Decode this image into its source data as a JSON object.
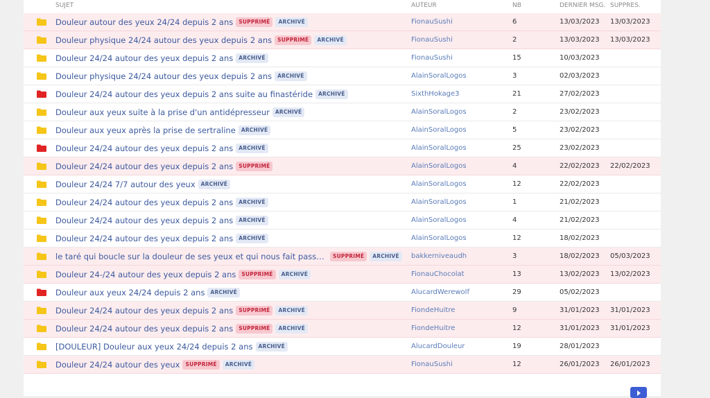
{
  "colors": {
    "folder_yellow": "#f5c518",
    "folder_red": "#e02424"
  },
  "badges": {
    "supprime": "SUPPRIMÉ",
    "archive": "ARCHIVÉ"
  },
  "header": {
    "sujet": "SUJET",
    "auteur": "AUTEUR",
    "nb": "NB",
    "dernier": "DERNIER MSG.",
    "suppres": "SUPPRES."
  },
  "rows": [
    {
      "icon": "yellow",
      "subject": "Douleur autour des yeux 24/24 depuis 2 ans",
      "supprime": true,
      "archive": true,
      "author": "FionauSushi",
      "nb": "6",
      "last": "13/03/2023",
      "deleted": "13/03/2023"
    },
    {
      "icon": "yellow",
      "subject": "Douleur physique 24/24 autour des yeux depuis 2 ans",
      "supprime": true,
      "archive": true,
      "author": "FionauSushi",
      "nb": "2",
      "last": "13/03/2023",
      "deleted": "13/03/2023"
    },
    {
      "icon": "yellow",
      "subject": "Douleur 24/24 autour des yeux depuis 2 ans",
      "supprime": false,
      "archive": true,
      "author": "FionauSushi",
      "nb": "15",
      "last": "10/03/2023",
      "deleted": ""
    },
    {
      "icon": "yellow",
      "subject": "Douleur physique 24/24 autour des yeux depuis 2 ans",
      "supprime": false,
      "archive": true,
      "author": "AlainSoralLogos",
      "nb": "3",
      "last": "02/03/2023",
      "deleted": ""
    },
    {
      "icon": "red",
      "subject": "Douleur 24/24 autour des yeux depuis 2 ans suite au finastéride",
      "supprime": false,
      "archive": true,
      "author": "SixthHokage3",
      "nb": "21",
      "last": "27/02/2023",
      "deleted": ""
    },
    {
      "icon": "yellow",
      "subject": "Douleur aux yeux suite à la prise d'un antidépresseur",
      "supprime": false,
      "archive": true,
      "author": "AlainSoralLogos",
      "nb": "2",
      "last": "23/02/2023",
      "deleted": ""
    },
    {
      "icon": "yellow",
      "subject": "Douleur aux yeux après la prise de sertraline",
      "supprime": false,
      "archive": true,
      "author": "AlainSoralLogos",
      "nb": "5",
      "last": "23/02/2023",
      "deleted": ""
    },
    {
      "icon": "red",
      "subject": "Douleur 24/24 autour des yeux depuis 2 ans",
      "supprime": false,
      "archive": true,
      "author": "AlainSoralLogos",
      "nb": "25",
      "last": "23/02/2023",
      "deleted": ""
    },
    {
      "icon": "yellow",
      "subject": "Douleur 24/24 autour des yeux depuis 2 ans",
      "supprime": true,
      "archive": false,
      "author": "AlainSoralLogos",
      "nb": "4",
      "last": "22/02/2023",
      "deleted": "22/02/2023"
    },
    {
      "icon": "yellow",
      "subject": "Douleur 24/24 7/7 autour des yeux",
      "supprime": false,
      "archive": true,
      "author": "AlainSoralLogos",
      "nb": "12",
      "last": "22/02/2023",
      "deleted": ""
    },
    {
      "icon": "yellow",
      "subject": "Douleur 24/24 autour des yeux depuis 2 ans",
      "supprime": false,
      "archive": true,
      "author": "AlainSoralLogos",
      "nb": "1",
      "last": "21/02/2023",
      "deleted": ""
    },
    {
      "icon": "yellow",
      "subject": "Douleur 24/24 autour des yeux depuis 2 ans",
      "supprime": false,
      "archive": true,
      "author": "AlainSoralLogos",
      "nb": "4",
      "last": "21/02/2023",
      "deleted": ""
    },
    {
      "icon": "yellow",
      "subject": "Douleur 24/24 autour des yeux depuis 2 ans",
      "supprime": false,
      "archive": true,
      "author": "AlainSoralLogos",
      "nb": "12",
      "last": "18/02/2023",
      "deleted": ""
    },
    {
      "icon": "yellow",
      "subject": "le taré qui boucle sur la douleur de ses yeux et qui nous fait passer pour d...",
      "supprime": true,
      "archive": true,
      "author": "bakkerniveaudh",
      "nb": "3",
      "last": "18/02/2023",
      "deleted": "05/03/2023"
    },
    {
      "icon": "yellow",
      "subject": "Douleur 24-/24 autour des yeux depuis 2 ans",
      "supprime": true,
      "archive": true,
      "author": "FionauChocolat",
      "nb": "13",
      "last": "13/02/2023",
      "deleted": "13/02/2023"
    },
    {
      "icon": "red",
      "subject": "Douleur aux yeux 24/24 depuis 2 ans",
      "supprime": false,
      "archive": true,
      "author": "AlucardWerewolf",
      "nb": "29",
      "last": "05/02/2023",
      "deleted": ""
    },
    {
      "icon": "yellow",
      "subject": "Douleur 24/24 autour des yeux depuis 2 ans",
      "supprime": true,
      "archive": true,
      "author": "FiondeHuitre",
      "nb": "9",
      "last": "31/01/2023",
      "deleted": "31/01/2023"
    },
    {
      "icon": "yellow",
      "subject": "Douleur 24/24 autour des yeux depuis 2 ans",
      "supprime": true,
      "archive": true,
      "author": "FiondeHuitre",
      "nb": "12",
      "last": "31/01/2023",
      "deleted": "31/01/2023"
    },
    {
      "icon": "yellow",
      "subject": "[DOULEUR] Douleur aux yeux 24/24 depuis 2 ans",
      "supprime": false,
      "archive": true,
      "author": "AlucardDouleur",
      "nb": "19",
      "last": "28/01/2023",
      "deleted": ""
    },
    {
      "icon": "yellow",
      "subject": "Douleur 24/24 autour des yeux",
      "supprime": true,
      "archive": true,
      "author": "FionauSushi",
      "nb": "12",
      "last": "26/01/2023",
      "deleted": "26/01/2023"
    }
  ]
}
